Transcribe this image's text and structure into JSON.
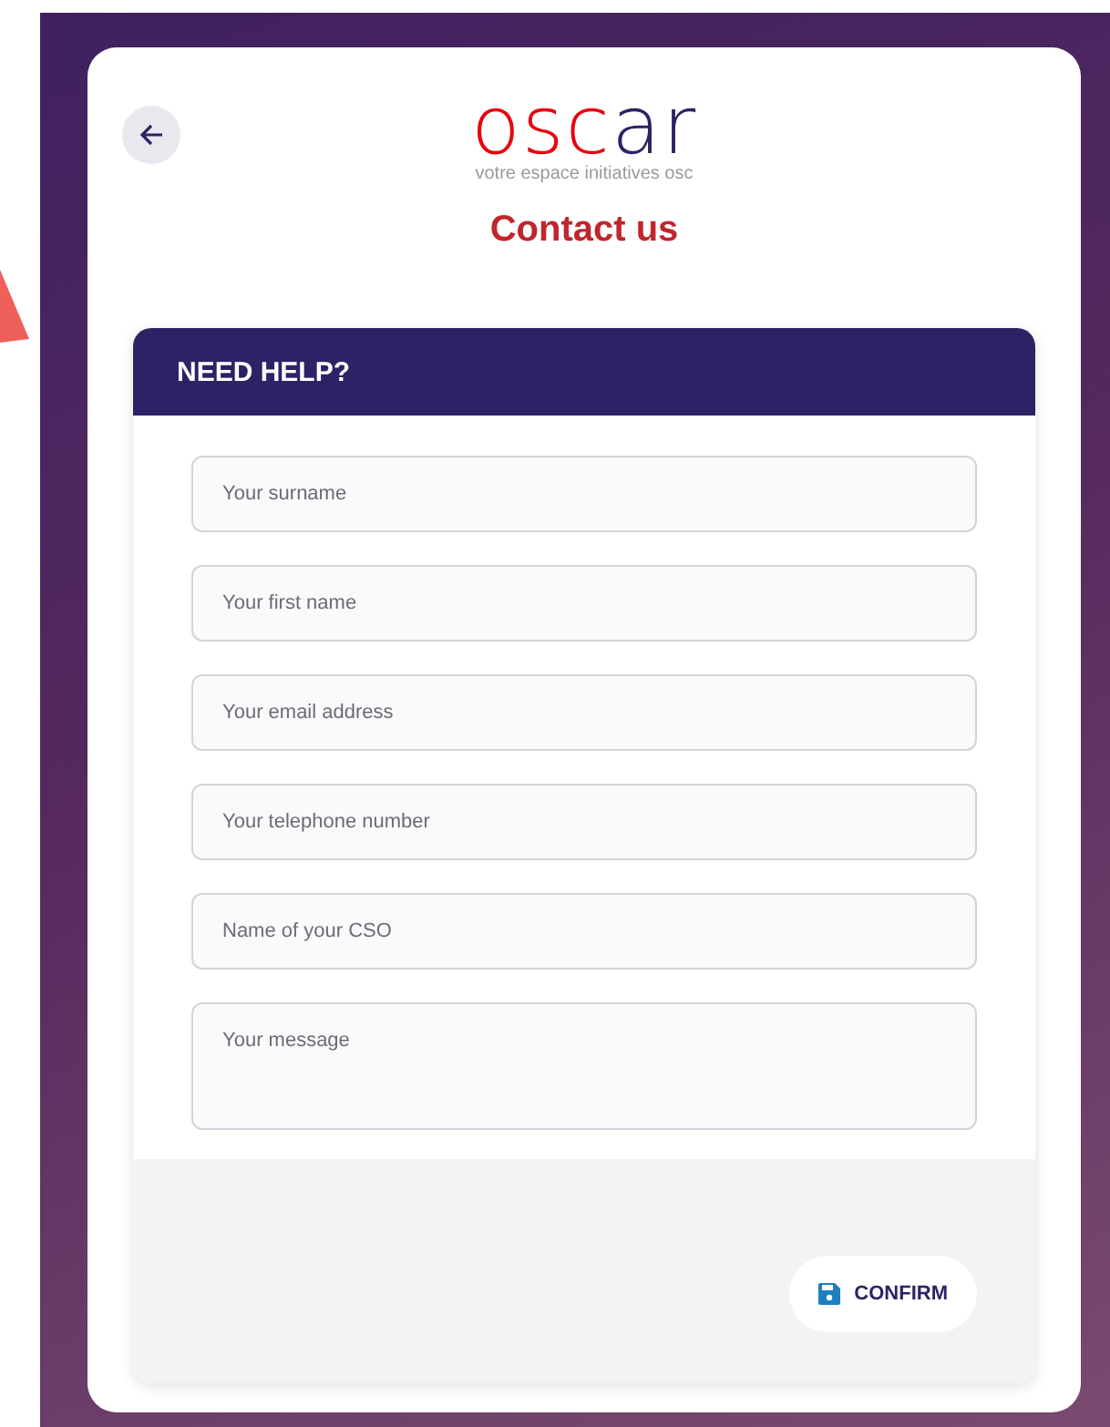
{
  "logo": {
    "parts": [
      {
        "text": "osc",
        "color": "#e8000d"
      },
      {
        "text": "ar",
        "color": "#2e2266"
      }
    ],
    "tagline": "votre espace initiatives osc"
  },
  "title": "Contact us",
  "form": {
    "heading": "NEED HELP?",
    "fields": [
      {
        "kind": "input",
        "placeholder": "Your surname"
      },
      {
        "kind": "input",
        "placeholder": "Your first name"
      },
      {
        "kind": "input",
        "placeholder": "Your email address"
      },
      {
        "kind": "input",
        "placeholder": "Your telephone number"
      },
      {
        "kind": "input",
        "placeholder": "Name of your CSO"
      },
      {
        "kind": "textarea",
        "placeholder": "Your message"
      }
    ],
    "submit": "CONFIRM"
  }
}
